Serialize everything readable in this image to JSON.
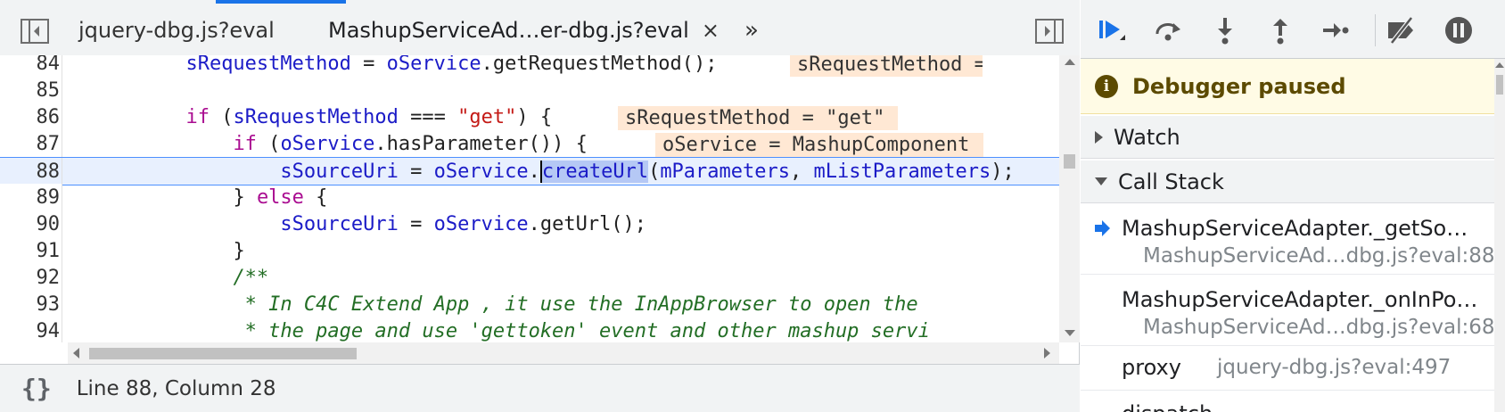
{
  "tabs": [
    {
      "label": "jquery-dbg.js?eval"
    },
    {
      "label": "MashupServiceAd…er-dbg.js?eval",
      "close": "×"
    }
  ],
  "overflow_label": "»",
  "code_lines": [
    {
      "num": "84"
    },
    {
      "num": "85"
    },
    {
      "num": "86"
    },
    {
      "num": "87"
    },
    {
      "num": "88"
    },
    {
      "num": "89"
    },
    {
      "num": "90"
    },
    {
      "num": "91"
    },
    {
      "num": "92"
    },
    {
      "num": "93"
    },
    {
      "num": "94"
    }
  ],
  "code_text": {
    "l84_a": "sRequestMethod",
    "l84_b": " = ",
    "l84_c": "oService",
    "l84_d": ".getRequestMethod();",
    "l86_kw": "if",
    "l86_a": " (",
    "l86_b": "sRequestMethod",
    "l86_c": " === ",
    "l86_d": "\"get\"",
    "l86_e": ") {",
    "l87_kw": "if",
    "l87_a": " (",
    "l87_b": "oService",
    "l87_c": ".hasParameter()) {",
    "l88_a": "sSourceUri",
    "l88_b": " = ",
    "l88_c": "oService",
    "l88_d": ".",
    "l88_sel": "createUrl",
    "l88_e": "(",
    "l88_f": "mParameters",
    "l88_g": ", ",
    "l88_h": "mListParameters",
    "l88_i": ");",
    "l89_a": "} ",
    "l89_kw": "else",
    "l89_b": " {",
    "l90_a": "sSourceUri",
    "l90_b": " = ",
    "l90_c": "oService",
    "l90_d": ".getUrl();",
    "l91_a": "}",
    "l92_a": "/**",
    "l93_a": " * In C4C Extend App , it use the InAppBrowser to open the",
    "l94_a": " * the page and use 'gettoken' event and other mashup servi"
  },
  "inline_values": {
    "l84": "sRequestMethod = \"get\"",
    "l86": "sRequestMethod = \"get\"",
    "l87": "oService = MashupComponent"
  },
  "status": {
    "pretty_print": "{}",
    "cursor": "Line 88, Column 28"
  },
  "debugger": {
    "paused_icon": "i",
    "paused_text": "Debugger paused",
    "watch_label": "Watch",
    "callstack_label": "Call Stack",
    "frames": [
      {
        "fn": "MashupServiceAdapter._getSo…",
        "loc": "MashupServiceAd…dbg.js?eval:88"
      },
      {
        "fn": "MashupServiceAdapter._onInPo…",
        "loc": "MashupServiceAd…dbg.js?eval:68"
      },
      {
        "fn": "proxy",
        "loc": "jquery-dbg.js?eval:497"
      },
      {
        "fn": "dispatch"
      }
    ]
  },
  "colors": {
    "accent": "#1a73e8",
    "paused_bg": "#fffbe5",
    "paused_text": "#5c4a00",
    "current_line": "#e8f0fe",
    "inline_value_bg": "#ffe8d4"
  }
}
